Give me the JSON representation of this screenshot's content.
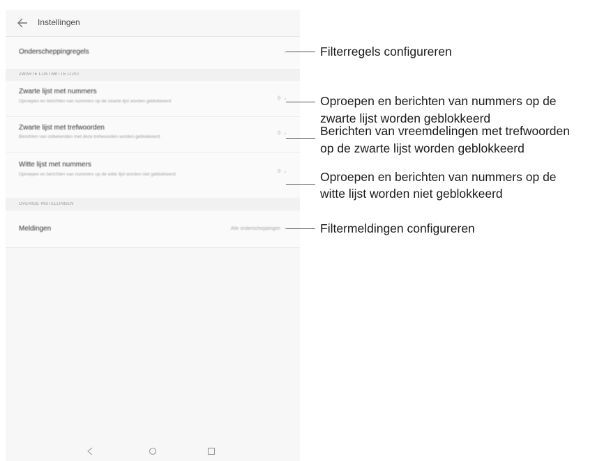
{
  "app": {
    "title": "Instellingen",
    "back_icon": "arrow-left-icon"
  },
  "rows": {
    "interception_rules": {
      "title": "Onderscheppingregels"
    },
    "blacklist_numbers": {
      "title": "Zwarte lijst met nummers",
      "subtitle": "Oproepen en berichten van nummers op de zwarte lijst worden geblokkeerd",
      "value": "0"
    },
    "blacklist_keywords": {
      "title": "Zwarte lijst met trefwoorden",
      "subtitle": "Berichten van onbekenden met deze trefwoorden worden geblokkeerd",
      "value": "0"
    },
    "whitelist_numbers": {
      "title": "Witte lijst met nummers",
      "subtitle": "Oproepen en berichten van nummers op de witte lijst worden niet geblokkeerd",
      "value": "0"
    },
    "notifications": {
      "title": "Meldingen",
      "value": "Alle onderscheppingen"
    }
  },
  "sections": {
    "lists": "ZWARTE LIJST/WITTE LIJST",
    "other": "OVERIGE INSTELLINGEN"
  },
  "navbar": {
    "back_icon": "triangle-back-icon",
    "home_icon": "circle-home-icon",
    "recents_icon": "square-recents-icon"
  },
  "callouts": {
    "rules": "Filterregels configureren",
    "blacklist_numbers_l1": "Oproepen en berichten van nummers op de",
    "blacklist_numbers_l2": "zwarte lijst worden geblokkeerd",
    "blacklist_keywords_l1": "Berichten van vreemdelingen met trefwoorden",
    "blacklist_keywords_l2": "op de zwarte lijst worden geblokkeerd",
    "whitelist_l1": "Oproepen en berichten van nummers op de",
    "whitelist_l2": "witte lijst worden niet geblokkeerd",
    "notifications": "Filtermeldingen configureren"
  },
  "colors": {
    "screen_background": "#f7f7f7",
    "section_background": "#f1f1f1",
    "leader_line": "#555555"
  }
}
